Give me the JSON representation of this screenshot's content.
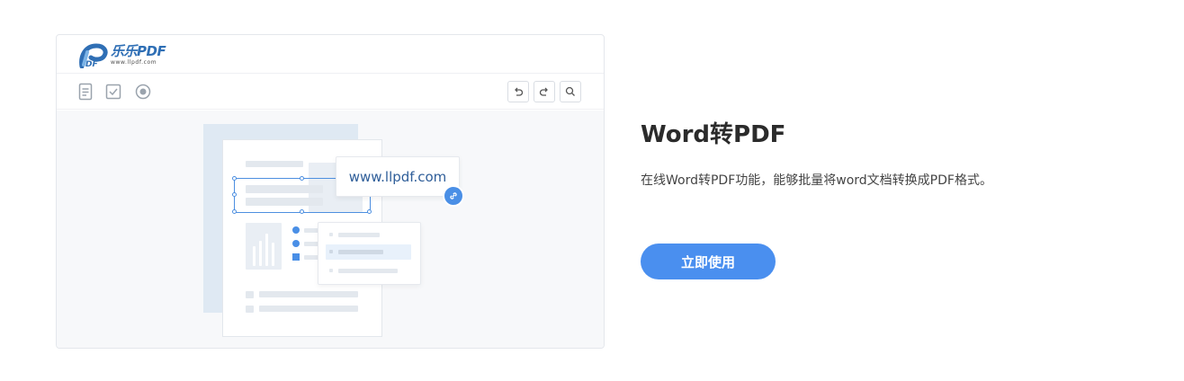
{
  "preview": {
    "logo": {
      "text": "乐乐PDF",
      "url": "www.llpdf.com"
    },
    "toolbar": {
      "left_icons": [
        "document-icon",
        "checkbox-icon",
        "record-icon"
      ],
      "right_buttons": [
        "undo-icon",
        "redo-icon",
        "search-icon"
      ]
    },
    "illustration": {
      "url_text": "www.llpdf.com",
      "badge_icon": "link-icon"
    }
  },
  "feature": {
    "title": "Word转PDF",
    "description": "在线Word转PDF功能，能够批量将word文档转换成PDF格式。",
    "cta_label": "立即使用"
  },
  "colors": {
    "accent": "#4a8fef",
    "logo_blue": "#2f6fb5",
    "title": "#2b2b2b",
    "text": "#444444"
  }
}
